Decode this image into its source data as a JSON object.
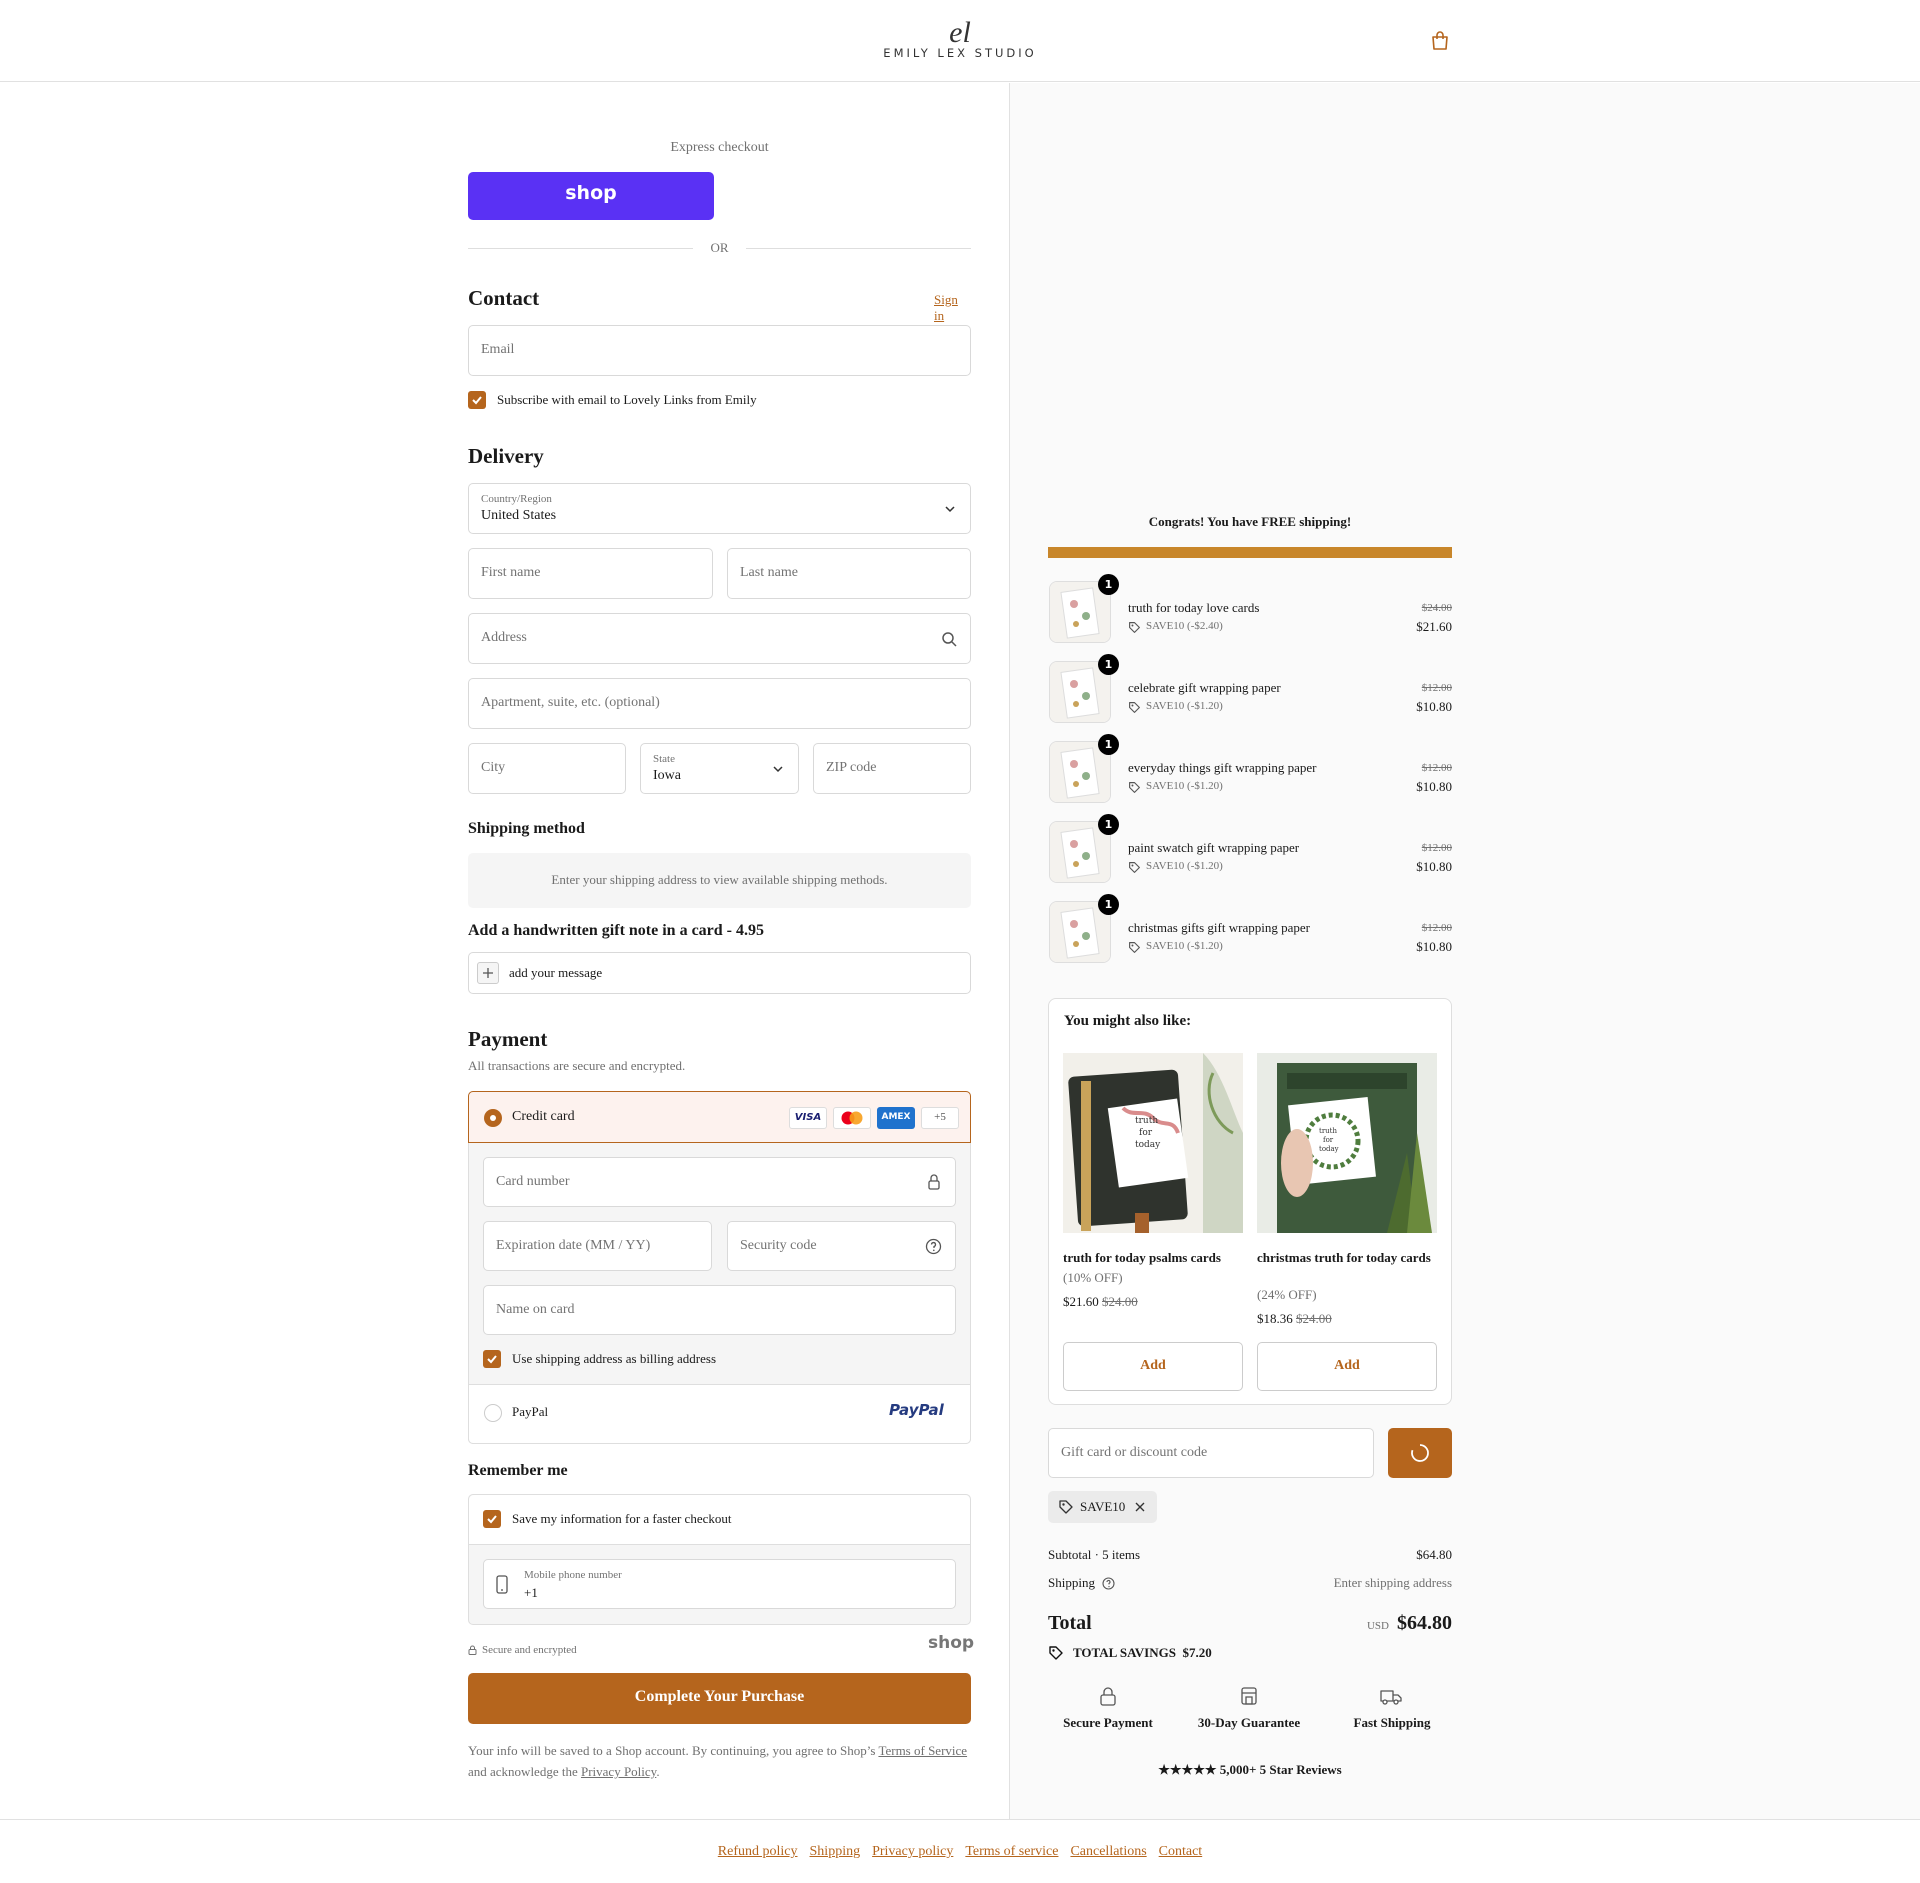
{
  "header": {
    "logo_mark": "el",
    "logo_text": "EMILY LEX STUDIO"
  },
  "express": {
    "label": "Express checkout",
    "shop_button": "shop",
    "or": "OR"
  },
  "contact": {
    "title": "Contact",
    "sign_in": "Sign in",
    "email_placeholder": "Email",
    "subscribe_label": "Subscribe with email to Lovely Links from Emily"
  },
  "delivery": {
    "title": "Delivery",
    "country_label": "Country/Region",
    "country_value": "United States",
    "first_name": "First name",
    "last_name": "Last name",
    "address": "Address",
    "apartment": "Apartment, suite, etc. (optional)",
    "city": "City",
    "state_label": "State",
    "state_value": "Iowa",
    "zip": "ZIP code"
  },
  "shipping_method": {
    "title": "Shipping method",
    "message": "Enter your shipping address to view available shipping methods."
  },
  "gift_note": {
    "title": "Add a handwritten gift note in a card - 4.95",
    "placeholder": "add your message"
  },
  "payment": {
    "title": "Payment",
    "subtitle": "All transactions are secure and encrypted.",
    "credit_card": "Credit card",
    "more_cards": "+5",
    "card_brands": [
      "VISA",
      "AMEX"
    ],
    "card_number": "Card number",
    "expiration": "Expiration date (MM / YY)",
    "security_code": "Security code",
    "name_on_card": "Name on card",
    "billing_same": "Use shipping address as billing address",
    "paypal": "PayPal",
    "paypal_logo": "PayPal"
  },
  "remember": {
    "title": "Remember me",
    "save_info": "Save my information for a faster checkout",
    "phone_label": "Mobile phone number",
    "phone_value": "+1",
    "secure": "Secure and encrypted",
    "shop_logo": "shop"
  },
  "complete_button": "Complete Your Purchase",
  "legal": {
    "text1": "Your info will be saved to a Shop account. By continuing, you agree to Shop’s ",
    "tos": "Terms of Service",
    "text2": "and acknowledge the ",
    "privacy": "Privacy Policy",
    "text3": "."
  },
  "footer": {
    "links": [
      "Refund policy",
      "Shipping",
      "Privacy policy",
      "Terms of service",
      "Cancellations",
      "Contact"
    ]
  },
  "summary": {
    "free_shipping": "Congrats! You have FREE shipping!",
    "free_shipping_progress": 1.0,
    "items": [
      {
        "qty": "1",
        "name": "truth for today love cards",
        "discount": "SAVE10 (-$2.40)",
        "original": "$24.00",
        "price": "$21.60"
      },
      {
        "qty": "1",
        "name": "celebrate gift wrapping paper",
        "discount": "SAVE10 (-$1.20)",
        "original": "$12.00",
        "price": "$10.80"
      },
      {
        "qty": "1",
        "name": "everyday things gift wrapping paper",
        "discount": "SAVE10 (-$1.20)",
        "original": "$12.00",
        "price": "$10.80"
      },
      {
        "qty": "1",
        "name": "paint swatch gift wrapping paper",
        "discount": "SAVE10 (-$1.20)",
        "original": "$12.00",
        "price": "$10.80"
      },
      {
        "qty": "1",
        "name": "christmas gifts gift wrapping paper",
        "discount": "SAVE10 (-$1.20)",
        "original": "$12.00",
        "price": "$10.80"
      }
    ],
    "upsell": {
      "title": "You might also like:",
      "products": [
        {
          "name": "truth for today psalms cards",
          "off": "(10% OFF)",
          "price": "$21.60",
          "original": "$24.00",
          "add": "Add"
        },
        {
          "name": "christmas truth for today cards",
          "off": "(24% OFF)",
          "price": "$18.36",
          "original": "$24.00",
          "add": "Add"
        }
      ]
    },
    "discount_placeholder": "Gift card or discount code",
    "applied_code": "SAVE10",
    "subtotal_label": "Subtotal · 5 items",
    "subtotal_value": "$64.80",
    "shipping_label": "Shipping",
    "shipping_value": "Enter shipping address",
    "total_label": "Total",
    "currency": "USD",
    "total_value": "$64.80",
    "savings_label": "TOTAL SAVINGS",
    "savings_value": "$7.20",
    "badges": [
      "Secure Payment",
      "30-Day Guarantee",
      "Fast Shipping"
    ],
    "reviews": "★★★★★ 5,000+ 5 Star Reviews"
  },
  "colors": {
    "accent": "#b5651d",
    "shop_purple": "#5a31f4",
    "highlight_bg": "#fdf2ee"
  }
}
